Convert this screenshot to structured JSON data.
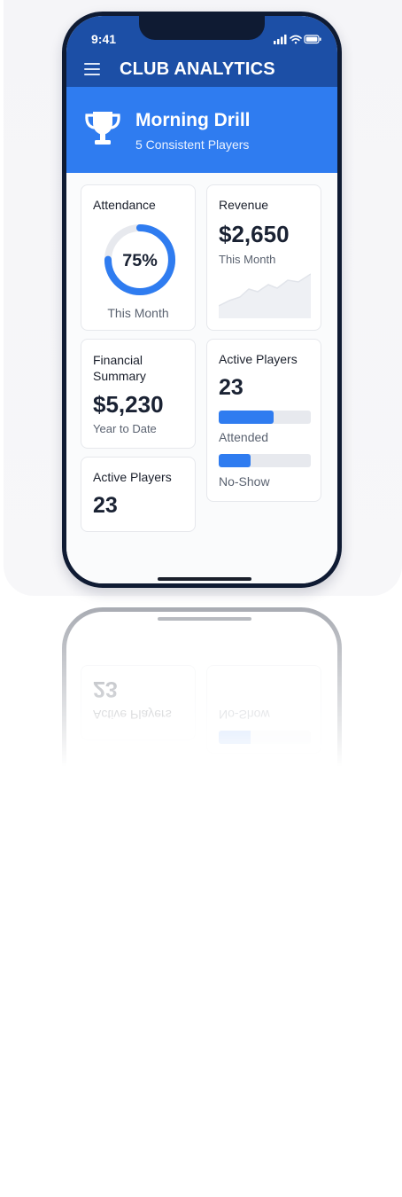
{
  "status_bar": {
    "time": "9:41"
  },
  "app_bar": {
    "title": "CLUB ANALYTICS"
  },
  "hero": {
    "title": "Morning Drill",
    "subtitle": "5 Consistent Players",
    "icon": "trophy-icon"
  },
  "cards": {
    "attendance": {
      "title": "Attendance",
      "percent_label": "75%",
      "percent": 75,
      "period": "This Month"
    },
    "revenue": {
      "title": "Revenue",
      "value": "$2,650",
      "period": "This Month"
    },
    "financial": {
      "title": "Financial Summary",
      "value": "$5,230",
      "period": "Year to Date"
    },
    "active_players_right": {
      "title": "Active Players",
      "value": "23",
      "bars": [
        {
          "label": "Attended",
          "fill": 0.6
        },
        {
          "label": "No-Show",
          "fill": 0.35
        }
      ]
    },
    "active_players_left": {
      "title": "Active Players",
      "value": "23"
    }
  },
  "colors": {
    "app_bar": "#1c4fa6",
    "accent": "#2f7cf0",
    "frame": "#0f1b33"
  }
}
